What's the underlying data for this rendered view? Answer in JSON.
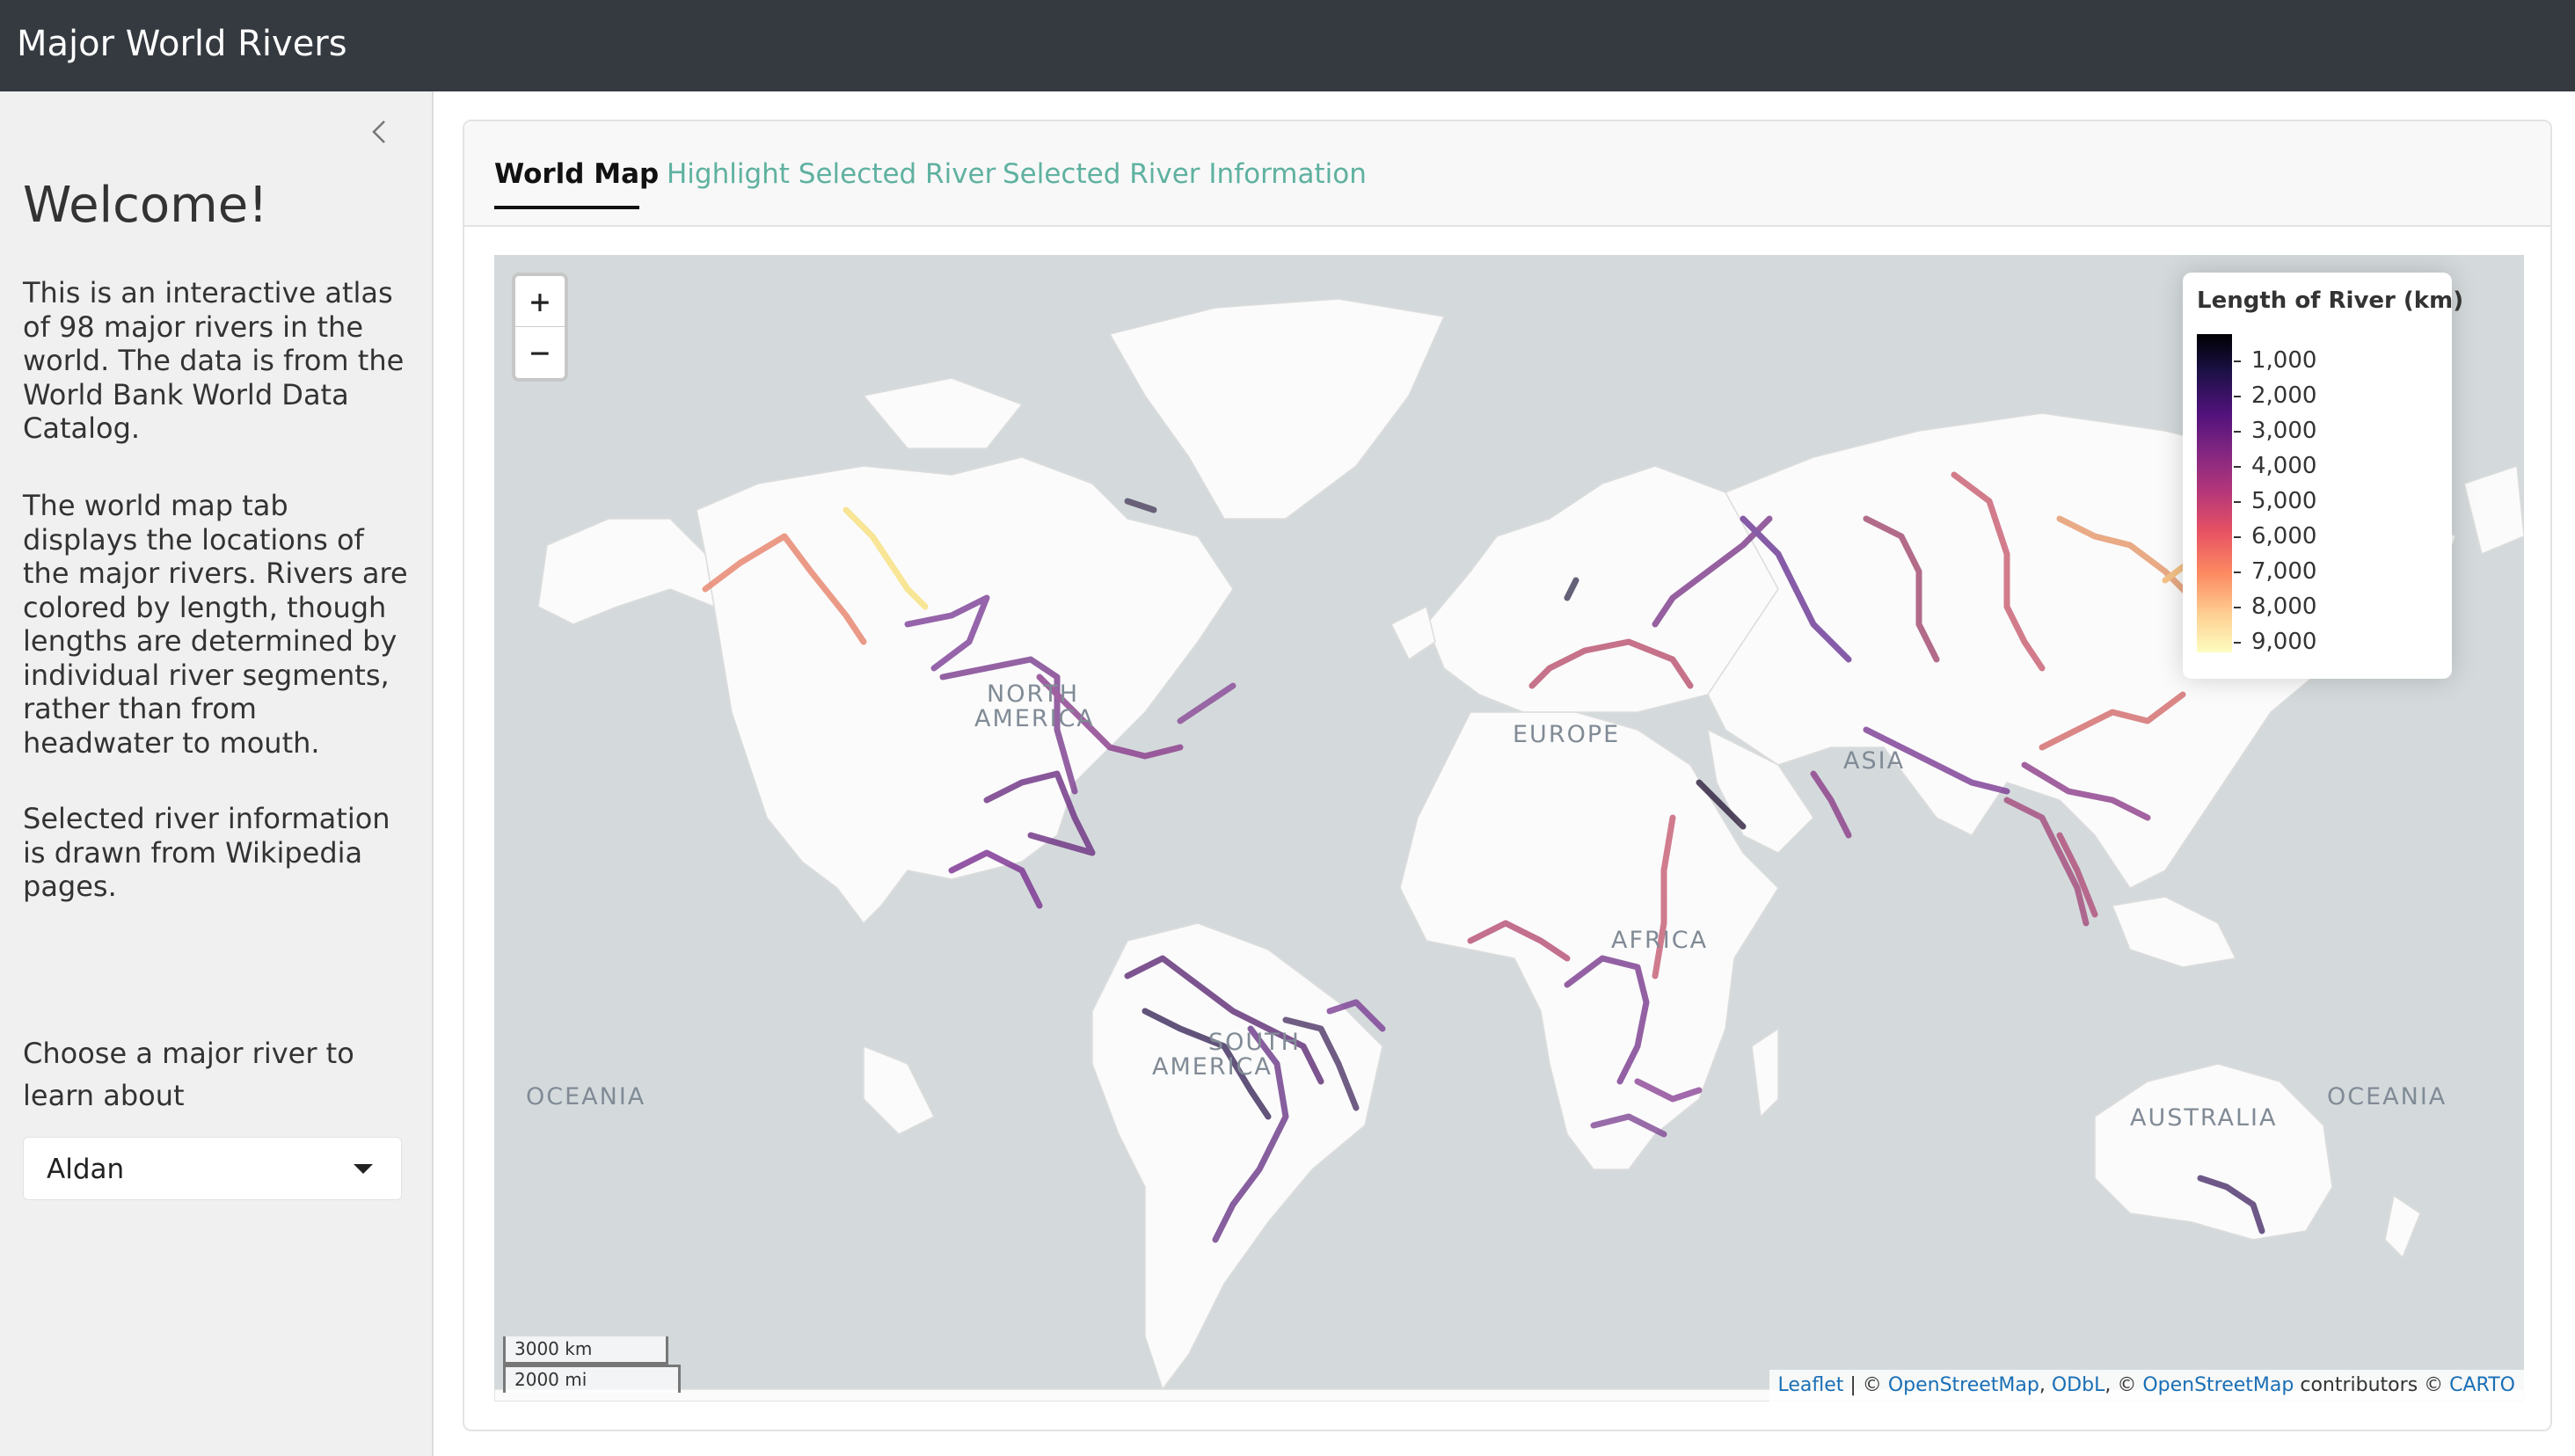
{
  "app": {
    "title": "Major World Rivers"
  },
  "sidebar": {
    "welcome": "Welcome!",
    "paragraphs": [
      "This is an interactive atlas of 98 major rivers in the world. The data is from the World Bank World Data Catalog.",
      "The world map tab displays the locations of the major rivers. Rivers are colored by length, though lengths are determined by individual river segments, rather than from headwater to mouth.",
      "Selected river information is drawn from Wikipedia pages."
    ],
    "select_label": "Choose a major river to learn about",
    "select_value": "Aldan",
    "collapse_icon": "chevron-left-icon"
  },
  "tabs": [
    {
      "label": "World Map",
      "active": true
    },
    {
      "label": "Highlight Selected River",
      "active": false
    },
    {
      "label": "Selected River Information",
      "active": false
    }
  ],
  "map": {
    "zoom_in": "+",
    "zoom_out": "−",
    "legend": {
      "title": "Length of River (km)",
      "labels": [
        "1,000",
        "2,000",
        "3,000",
        "4,000",
        "5,000",
        "6,000",
        "7,000",
        "8,000",
        "9,000"
      ],
      "colors": [
        "#000004",
        "#51127c",
        "#b73779",
        "#fc8961",
        "#fcfdbf"
      ]
    },
    "continent_labels": {
      "north_america_1": "NORTH",
      "north_america_2": "AMERICA",
      "south_america_1": "SOUTH",
      "south_america_2": "AMERICA",
      "europe": "EUROPE",
      "asia": "ASIA",
      "africa": "AFRICA",
      "australia": "AUSTRALIA",
      "oceania_west": "OCEANIA",
      "oceania_east": "OCEANIA"
    },
    "scale": {
      "km": "3000 km",
      "mi": "2000 mi"
    },
    "attribution": {
      "leaflet": "Leaflet",
      "sep1": " | © ",
      "osm1": "OpenStreetMap",
      "comma1": ", ",
      "odbl": "ODbL",
      "sep2": ", © ",
      "osm2": "OpenStreetMap",
      "contrib": " contributors © ",
      "carto": "CARTO"
    }
  }
}
